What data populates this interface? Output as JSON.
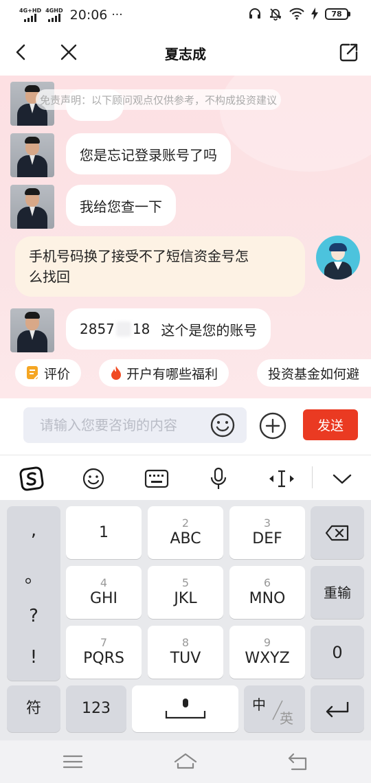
{
  "status_bar": {
    "sim1": "4G+HD",
    "sim2": "4GHD",
    "time": "20:06",
    "dots": "···",
    "battery": "78"
  },
  "header": {
    "title": "夏志成"
  },
  "chat": {
    "disclaimer": "免责声明：以下顾问观点仅供参考，不构成投资建议",
    "messages": [
      {
        "from": "advisor",
        "text": "您是忘记登录账号了吗"
      },
      {
        "from": "advisor",
        "text": "我给您查一下"
      },
      {
        "from": "user",
        "text_line1": "手机号码换了接受不了短信资金号怎",
        "text_line2": "么找回"
      },
      {
        "from": "advisor",
        "text_part1": "2857",
        "text_part2": "18",
        "text_part3": "这个是您的账号"
      }
    ]
  },
  "quick_replies": [
    {
      "icon": "rating-icon",
      "label": "评价"
    },
    {
      "icon": "fire-icon",
      "label": "开户有哪些福利"
    },
    {
      "label": "投资基金如何避"
    }
  ],
  "input": {
    "placeholder": "请输入您要咨询的内容",
    "send_label": "发送"
  },
  "keyboard": {
    "punctuation": [
      ",",
      "。",
      "?",
      "!"
    ],
    "rows": [
      [
        {
          "num": "",
          "main": "1"
        },
        {
          "num": "2",
          "main": "ABC"
        },
        {
          "num": "3",
          "main": "DEF"
        }
      ],
      [
        {
          "num": "4",
          "main": "GHI"
        },
        {
          "num": "5",
          "main": "JKL"
        },
        {
          "num": "6",
          "main": "MNO"
        }
      ],
      [
        {
          "num": "7",
          "main": "PQRS"
        },
        {
          "num": "8",
          "main": "TUV"
        },
        {
          "num": "9",
          "main": "WXYZ"
        }
      ]
    ],
    "reenter_label": "重输",
    "zero_label": "0",
    "symbol_label": "符",
    "numeric_label": "123",
    "lang_zh": "中",
    "lang_en": "英"
  },
  "colors": {
    "send": "#ea3a22",
    "chat_bg": "#fde0e3",
    "user_bubble": "#fdf2e4",
    "user_avatar": "#4cc3dd"
  }
}
